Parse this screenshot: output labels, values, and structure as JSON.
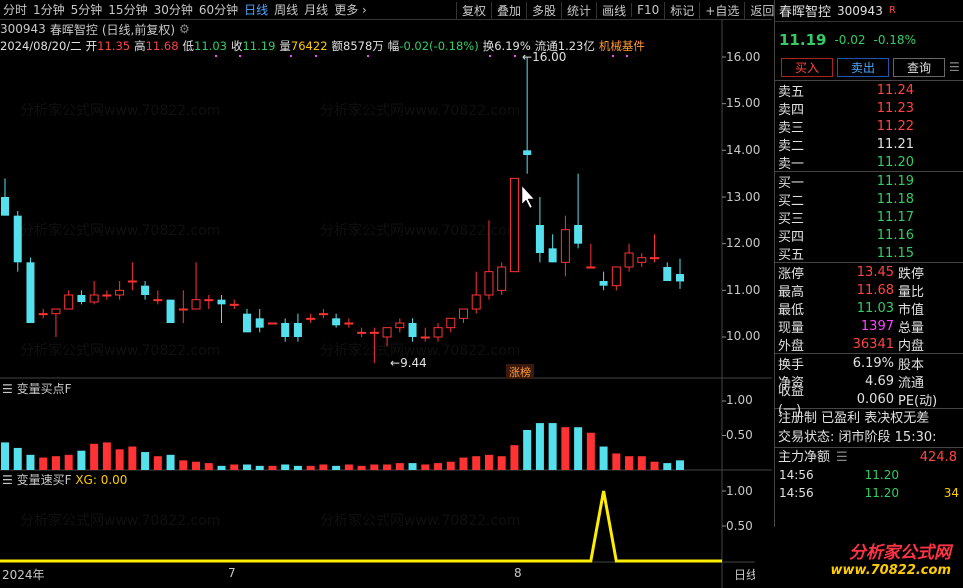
{
  "toolbar": {
    "periods": [
      "分时",
      "1分钟",
      "5分钟",
      "15分钟",
      "30分钟",
      "60分钟",
      "日线",
      "周线",
      "月线",
      "更多"
    ],
    "active": "日线",
    "right": [
      "复权",
      "叠加",
      "多股",
      "统计",
      "画线",
      "F10",
      "标记",
      "+自选",
      "返回"
    ]
  },
  "title": {
    "code": "300943",
    "name": "春晖智控",
    "suffix": "(日线,前复权)"
  },
  "info": {
    "date": "2024/08/20/二",
    "open_l": "开",
    "open": "11.35",
    "high_l": "高",
    "high": "11.68",
    "low_l": "低",
    "low": "11.03",
    "close_l": "收",
    "close": "11.19",
    "vol_l": "量",
    "vol": "76422",
    "amt_l": "额",
    "amt": "8578万",
    "chg_l": "幅",
    "chg": "-0.02(-0.18%)",
    "turn_l": "换",
    "turn": "6.19%",
    "float_l": "流通",
    "float": "1.23亿",
    "sector": "机械基件"
  },
  "annot": {
    "hi": "16.00",
    "lo": "9.44",
    "tag": "涨榜"
  },
  "ind1": {
    "name": "变量买点F"
  },
  "ind2": {
    "name": "变量速买F",
    "xg": "XG: 0.00"
  },
  "xlabels": [
    "2024年",
    "7",
    "8",
    "日线"
  ],
  "watermark": "分析家公式网www.70822.com",
  "chart_data": {
    "type": "candlestick",
    "y_ticks": [
      "16.00",
      "15.00",
      "14.00",
      "13.00",
      "12.00",
      "11.00",
      "10.00"
    ],
    "ind1_ticks": [
      "1.00",
      "0.50"
    ],
    "ind2_ticks": [
      "1.00",
      "0.50"
    ],
    "candles": [
      {
        "o": 13.0,
        "h": 13.4,
        "l": 12.6,
        "c": 12.6
      },
      {
        "o": 12.6,
        "h": 12.7,
        "l": 11.4,
        "c": 11.6
      },
      {
        "o": 11.6,
        "h": 11.7,
        "l": 10.3,
        "c": 10.3
      },
      {
        "o": 10.5,
        "h": 10.6,
        "l": 10.4,
        "c": 10.5
      },
      {
        "o": 10.5,
        "h": 10.6,
        "l": 10.0,
        "c": 10.6
      },
      {
        "o": 10.6,
        "h": 11.0,
        "l": 10.6,
        "c": 10.9
      },
      {
        "o": 10.9,
        "h": 11.0,
        "l": 10.7,
        "c": 10.75
      },
      {
        "o": 10.75,
        "h": 11.2,
        "l": 10.7,
        "c": 10.9
      },
      {
        "o": 10.9,
        "h": 11.0,
        "l": 10.8,
        "c": 10.9
      },
      {
        "o": 10.9,
        "h": 11.2,
        "l": 10.8,
        "c": 11.0
      },
      {
        "o": 11.2,
        "h": 11.6,
        "l": 11.0,
        "c": 11.2
      },
      {
        "o": 11.1,
        "h": 11.2,
        "l": 10.8,
        "c": 10.9
      },
      {
        "o": 10.8,
        "h": 11.0,
        "l": 10.7,
        "c": 10.8
      },
      {
        "o": 10.8,
        "h": 10.8,
        "l": 10.3,
        "c": 10.3
      },
      {
        "o": 10.6,
        "h": 11.0,
        "l": 10.3,
        "c": 10.6
      },
      {
        "o": 10.6,
        "h": 11.6,
        "l": 10.6,
        "c": 10.8
      },
      {
        "o": 10.8,
        "h": 10.9,
        "l": 10.6,
        "c": 10.8
      },
      {
        "o": 10.8,
        "h": 10.9,
        "l": 10.3,
        "c": 10.7
      },
      {
        "o": 10.7,
        "h": 10.8,
        "l": 10.6,
        "c": 10.7
      },
      {
        "o": 10.5,
        "h": 10.6,
        "l": 10.1,
        "c": 10.1
      },
      {
        "o": 10.4,
        "h": 10.6,
        "l": 10.1,
        "c": 10.2
      },
      {
        "o": 10.3,
        "h": 10.3,
        "l": 10.3,
        "c": 10.3
      },
      {
        "o": 10.3,
        "h": 10.4,
        "l": 9.9,
        "c": 10.0
      },
      {
        "o": 10.3,
        "h": 10.5,
        "l": 9.9,
        "c": 10.0
      },
      {
        "o": 10.4,
        "h": 10.5,
        "l": 10.3,
        "c": 10.4
      },
      {
        "o": 10.5,
        "h": 10.6,
        "l": 10.4,
        "c": 10.5
      },
      {
        "o": 10.4,
        "h": 10.5,
        "l": 10.2,
        "c": 10.25
      },
      {
        "o": 10.3,
        "h": 10.4,
        "l": 10.2,
        "c": 10.3
      },
      {
        "o": 10.1,
        "h": 10.2,
        "l": 10.0,
        "c": 10.1
      },
      {
        "o": 10.1,
        "h": 10.2,
        "l": 9.44,
        "c": 10.1
      },
      {
        "o": 10.0,
        "h": 10.2,
        "l": 9.8,
        "c": 10.2
      },
      {
        "o": 10.2,
        "h": 10.4,
        "l": 10.1,
        "c": 10.3
      },
      {
        "o": 10.3,
        "h": 10.4,
        "l": 9.9,
        "c": 10.0
      },
      {
        "o": 10.0,
        "h": 10.2,
        "l": 9.9,
        "c": 10.0
      },
      {
        "o": 10.0,
        "h": 10.3,
        "l": 9.9,
        "c": 10.2
      },
      {
        "o": 10.2,
        "h": 10.4,
        "l": 10.1,
        "c": 10.4
      },
      {
        "o": 10.4,
        "h": 10.6,
        "l": 10.3,
        "c": 10.6
      },
      {
        "o": 10.6,
        "h": 11.4,
        "l": 10.5,
        "c": 10.9
      },
      {
        "o": 10.9,
        "h": 12.5,
        "l": 10.8,
        "c": 11.4
      },
      {
        "o": 11.0,
        "h": 11.6,
        "l": 10.9,
        "c": 11.5
      },
      {
        "o": 11.4,
        "h": 13.4,
        "l": 11.4,
        "c": 13.4
      },
      {
        "o": 14.0,
        "h": 16.0,
        "l": 13.5,
        "c": 13.9
      },
      {
        "o": 12.4,
        "h": 13.0,
        "l": 11.6,
        "c": 11.8
      },
      {
        "o": 11.9,
        "h": 12.2,
        "l": 11.6,
        "c": 11.6
      },
      {
        "o": 11.6,
        "h": 12.6,
        "l": 11.3,
        "c": 12.3
      },
      {
        "o": 12.4,
        "h": 13.5,
        "l": 11.9,
        "c": 12.0
      },
      {
        "o": 11.5,
        "h": 12.0,
        "l": 11.5,
        "c": 11.5
      },
      {
        "o": 11.2,
        "h": 11.4,
        "l": 11.0,
        "c": 11.1
      },
      {
        "o": 11.1,
        "h": 11.5,
        "l": 11.0,
        "c": 11.5
      },
      {
        "o": 11.5,
        "h": 12.0,
        "l": 11.4,
        "c": 11.8
      },
      {
        "o": 11.6,
        "h": 11.8,
        "l": 11.5,
        "c": 11.7
      },
      {
        "o": 11.7,
        "h": 12.2,
        "l": 11.6,
        "c": 11.7
      },
      {
        "o": 11.5,
        "h": 11.6,
        "l": 11.2,
        "c": 11.2
      },
      {
        "o": 11.35,
        "h": 11.68,
        "l": 11.03,
        "c": 11.19
      }
    ],
    "ind1_values": [
      0.4,
      0.32,
      0.22,
      0.18,
      0.2,
      0.22,
      0.28,
      0.38,
      0.4,
      0.3,
      0.34,
      0.26,
      0.2,
      0.22,
      0.14,
      0.12,
      0.1,
      0.06,
      0.08,
      0.08,
      0.06,
      0.06,
      0.08,
      0.06,
      0.06,
      0.08,
      0.06,
      0.08,
      0.06,
      0.08,
      0.08,
      0.1,
      0.1,
      0.08,
      0.1,
      0.12,
      0.18,
      0.2,
      0.22,
      0.2,
      0.36,
      0.58,
      0.68,
      0.68,
      0.62,
      0.62,
      0.54,
      0.34,
      0.24,
      0.2,
      0.2,
      0.12,
      0.1,
      0.14
    ],
    "ind2_values": [
      0,
      0,
      0,
      0,
      0,
      0,
      0,
      0,
      0,
      0,
      0,
      0,
      0,
      0,
      0,
      0,
      0,
      0,
      0,
      0,
      0,
      0,
      0,
      0,
      0,
      0,
      0,
      0,
      0,
      0,
      0,
      0,
      0,
      0,
      0,
      0,
      0,
      0,
      0,
      0,
      0,
      0,
      0,
      0,
      0,
      0,
      0,
      1,
      0,
      0,
      0,
      0,
      0,
      0
    ]
  },
  "rpanel": {
    "name": "春晖智控",
    "code": "300943",
    "tag": "R",
    "price": "11.19",
    "chg": "-0.02",
    "pct": "-0.18%",
    "btn_buy": "买入",
    "btn_sell": "卖出",
    "btn_query": "查询",
    "sells": [
      {
        "l": "卖五",
        "v": "11.24",
        "c": "red"
      },
      {
        "l": "卖四",
        "v": "11.23",
        "c": "red"
      },
      {
        "l": "卖三",
        "v": "11.22",
        "c": "red"
      },
      {
        "l": "卖二",
        "v": "11.21",
        "c": "wht"
      },
      {
        "l": "卖一",
        "v": "11.20",
        "c": "grn"
      }
    ],
    "buys": [
      {
        "l": "买一",
        "v": "11.19",
        "c": "grn"
      },
      {
        "l": "买二",
        "v": "11.18",
        "c": "grn"
      },
      {
        "l": "买三",
        "v": "11.17",
        "c": "grn"
      },
      {
        "l": "买四",
        "v": "11.16",
        "c": "grn"
      },
      {
        "l": "买五",
        "v": "11.15",
        "c": "grn"
      }
    ],
    "stats1": [
      {
        "l": "涨停",
        "v": "13.45",
        "c": "red",
        "r": "跌停"
      },
      {
        "l": "最高",
        "v": "11.68",
        "c": "red",
        "r": "量比"
      },
      {
        "l": "最低",
        "v": "11.03",
        "c": "grn",
        "r": "市值"
      },
      {
        "l": "现量",
        "v": "1397",
        "c": "mag",
        "r": "总量"
      },
      {
        "l": "外盘",
        "v": "36341",
        "c": "red",
        "r": "内盘"
      }
    ],
    "stats2": [
      {
        "l": "换手",
        "v": "6.19%",
        "c": "wht",
        "r": "股本"
      },
      {
        "l": "净资",
        "v": "4.69",
        "c": "wht",
        "r": "流通"
      },
      {
        "l": "收益(一)",
        "v": "0.060",
        "c": "wht",
        "r": "PE(动)"
      }
    ],
    "note1": "注册制 已盈利 表决权无差",
    "note2_l": "交易状态: 闭市阶段",
    "note2_t": "15:30:",
    "main_l": "主力净额",
    "main_v": "424.8",
    "flows": [
      {
        "t": "14:56",
        "p": "11.20",
        "v": ""
      },
      {
        "t": "14:56",
        "p": "11.20",
        "v": "34"
      }
    ]
  },
  "logo": {
    "a": "分析家公式网",
    "b": "www.70822.com"
  }
}
